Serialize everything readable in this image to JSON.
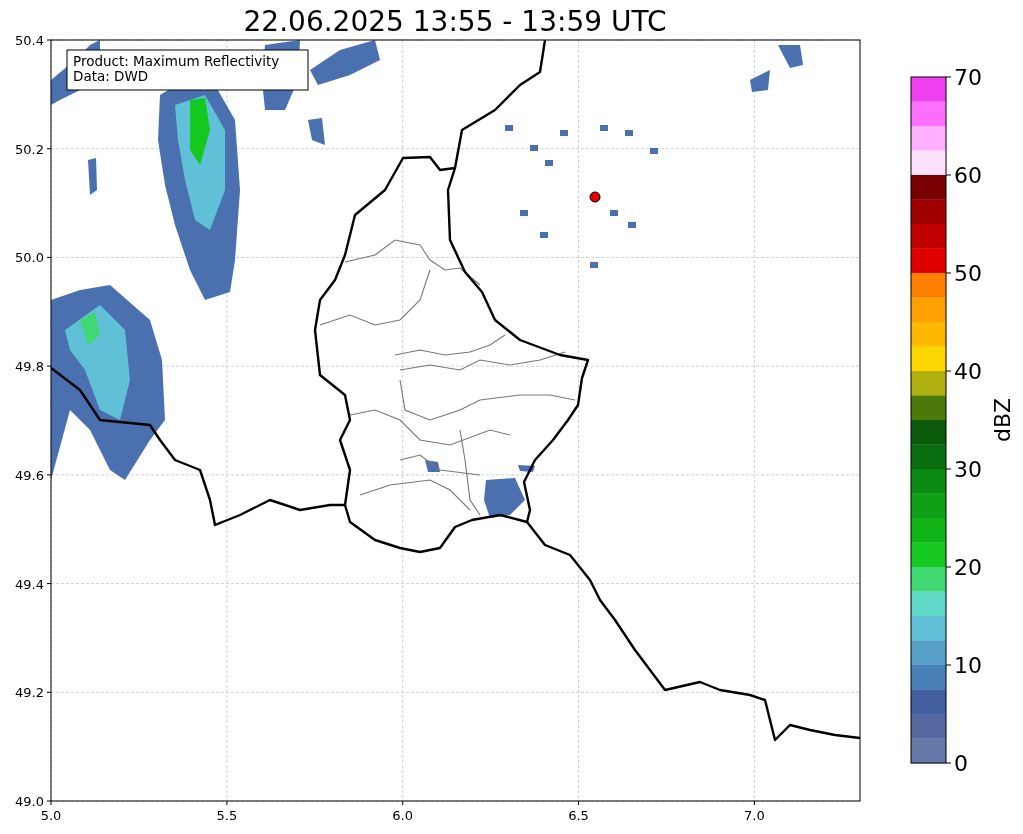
{
  "title": "22.06.2025 13:55 - 13:59 UTC",
  "info_box": {
    "lines": [
      "Product: Maximum Reflectivity",
      "Data: DWD"
    ]
  },
  "map": {
    "x_ticks": [
      "5.0",
      "5.5",
      "6.0",
      "6.5",
      "7.0"
    ],
    "y_ticks": [
      "50.4",
      "50.2",
      "50.0",
      "49.8",
      "49.6",
      "49.4",
      "49.2",
      "49.0"
    ]
  },
  "colorbar": {
    "label": "dBZ",
    "ticks": [
      "70",
      "60",
      "50",
      "40",
      "30",
      "20",
      "10",
      "0"
    ],
    "bands": [
      {
        "color": "#f040f0"
      },
      {
        "color": "#ff70ff"
      },
      {
        "color": "#ffb0ff"
      },
      {
        "color": "#ffe0ff"
      },
      {
        "color": "#780000"
      },
      {
        "color": "#a00000"
      },
      {
        "color": "#c00000"
      },
      {
        "color": "#e00000"
      },
      {
        "color": "#ff8000"
      },
      {
        "color": "#ffa000"
      },
      {
        "color": "#ffb800"
      },
      {
        "color": "#ffd700"
      },
      {
        "color": "#b0b010"
      },
      {
        "color": "#4b7a0a"
      },
      {
        "color": "#0a5a0a"
      },
      {
        "color": "#0a6e10"
      },
      {
        "color": "#0a8a10"
      },
      {
        "color": "#10a018"
      },
      {
        "color": "#10b418"
      },
      {
        "color": "#14c820"
      },
      {
        "color": "#40d870"
      },
      {
        "color": "#60d8c8"
      },
      {
        "color": "#60c0d8"
      },
      {
        "color": "#58a0c8"
      },
      {
        "color": "#4a80b8"
      },
      {
        "color": "#4560a0"
      },
      {
        "color": "#5568a0"
      },
      {
        "color": "#6678a8"
      }
    ]
  }
}
